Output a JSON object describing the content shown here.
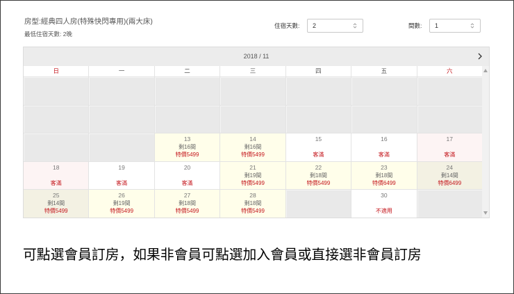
{
  "room": {
    "type_label": "房型:經典四人房(特殊快閃專用)(兩大床)",
    "min_stay_label": "最低住宿天數: 2晚"
  },
  "booking_controls": {
    "nights_label": "住宿天數:",
    "nights_value": "2",
    "rooms_label": "間數:",
    "rooms_value": "1"
  },
  "calendar": {
    "month_label": "2018 / 11",
    "weekdays": [
      "日",
      "一",
      "二",
      "三",
      "四",
      "五",
      "六"
    ],
    "weeks": [
      [
        {},
        {},
        {},
        {},
        {},
        {},
        {}
      ],
      [
        {},
        {},
        {},
        {},
        {},
        {},
        {}
      ],
      [
        {},
        {},
        {
          "day": "13",
          "remaining": "剩16間",
          "price": "特價5499"
        },
        {
          "day": "14",
          "remaining": "剩16間",
          "price": "特價5499"
        },
        {
          "day": "15",
          "note": "客滿"
        },
        {
          "day": "16",
          "note": "客滿"
        },
        {
          "day": "17",
          "note": "客滿"
        }
      ],
      [
        {
          "day": "18",
          "note": "客滿"
        },
        {
          "day": "19",
          "note": "客滿"
        },
        {
          "day": "20",
          "note": "客滿"
        },
        {
          "day": "21",
          "remaining": "剩19間",
          "price": "特價5499"
        },
        {
          "day": "22",
          "remaining": "剩18間",
          "price": "特價5499"
        },
        {
          "day": "23",
          "remaining": "剩18間",
          "price": "特價6499"
        },
        {
          "day": "24",
          "remaining": "剩14間",
          "price": "特價6499"
        }
      ],
      [
        {
          "day": "25",
          "remaining": "剩14間",
          "price": "特價5499"
        },
        {
          "day": "26",
          "remaining": "剩19間",
          "price": "特價5499"
        },
        {
          "day": "27",
          "remaining": "剩18間",
          "price": "特價5499"
        },
        {
          "day": "28",
          "remaining": "剩18間",
          "price": "特價5499"
        },
        {},
        {
          "day": "30",
          "note": "不適用"
        },
        {}
      ]
    ]
  },
  "instruction_text": "可點選會員訂房，如果非會員可點選加入會員或直接選非會員訂房",
  "icons": {
    "select_arrows": "updown-chevron-icon",
    "next_month": "chevron-right-icon",
    "scroll_up": "scroll-up-arrow-icon",
    "scroll_down": "scroll-down-arrow-icon"
  },
  "colors": {
    "accent_red": "#c4161c",
    "available_bg": "#fffeea",
    "weekend_available_bg": "#f3f1e3",
    "weekend_full_bg": "#fdf4f4",
    "empty_bg": "#e9e9e9",
    "header_bg": "#ececec"
  }
}
